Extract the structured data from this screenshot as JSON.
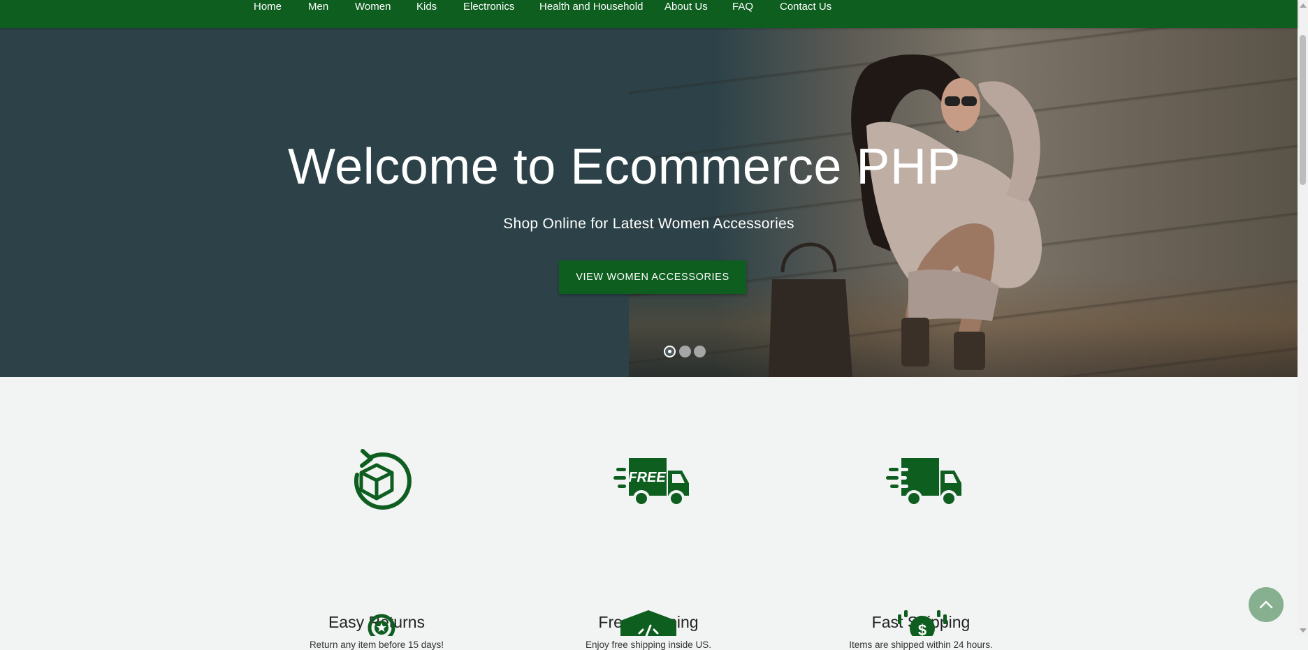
{
  "nav": {
    "items": [
      {
        "label": "Home"
      },
      {
        "label": "Men"
      },
      {
        "label": "Women"
      },
      {
        "label": "Kids"
      },
      {
        "label": "Electronics"
      },
      {
        "label": "Health and Household"
      },
      {
        "label": "About Us"
      },
      {
        "label": "FAQ"
      },
      {
        "label": "Contact Us"
      }
    ]
  },
  "hero": {
    "title": "Welcome to Ecommerce PHP",
    "subtitle": "Shop Online for Latest Women Accessories",
    "button_label": "VIEW WOMEN ACCESSORIES",
    "slides": 3,
    "active_slide": 1
  },
  "features": [
    {
      "title": "Easy Returns",
      "text": "Return any item before 15 days!",
      "icon": "return-box-icon"
    },
    {
      "title": "Free Shipping",
      "text": "Enjoy free shipping inside US.",
      "icon": "free-delivery-truck-icon",
      "icon_text": "FREE"
    },
    {
      "title": "Fast Shipping",
      "text": "Items are shipped within 24 hours.",
      "icon": "fast-delivery-truck-icon"
    }
  ],
  "colors": {
    "brand_green": "#0d5e1f",
    "hero_overlay": "#2c4248",
    "page_bg": "#f2f3f3",
    "back_to_top": "#86b08f"
  }
}
